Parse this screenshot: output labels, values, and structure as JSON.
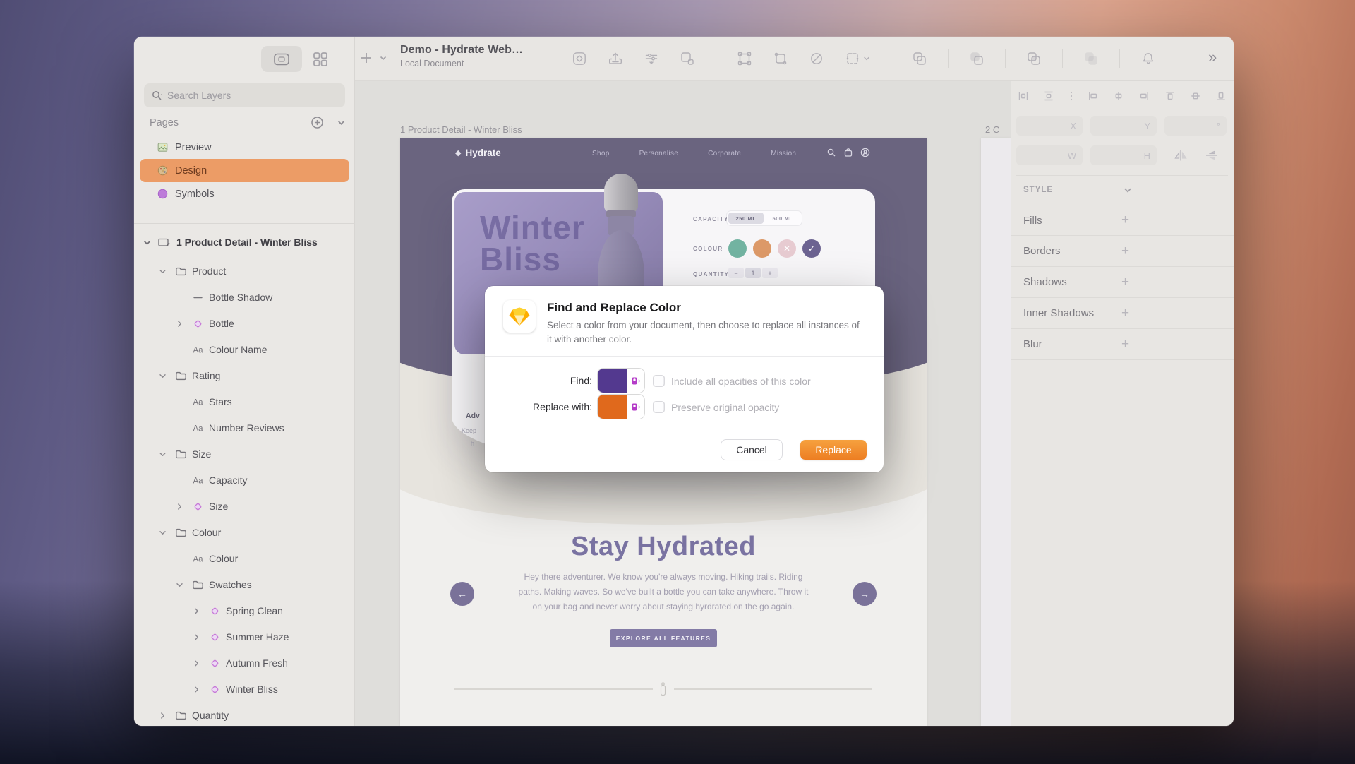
{
  "window": {
    "title": "Demo - Hydrate Web…",
    "subtitle": "Local Document",
    "overflow_glyph": "»"
  },
  "toolbar": {
    "icons": [
      "symbol-tool",
      "upload-tool",
      "tune-tool",
      "mask-tool",
      "sep",
      "vector-edit-tool",
      "transform-tool",
      "no-fill-tool",
      "resize-tool",
      "sep",
      "boolean-union",
      "sep",
      "boolean-subtract",
      "sep",
      "boolean-intersect",
      "sep",
      "boolean-difference",
      "sep",
      "notifications-bell"
    ]
  },
  "sidebar": {
    "search_placeholder": "Search Layers",
    "pages_label": "Pages",
    "pages": [
      {
        "label": "Preview",
        "icon": "page-preview",
        "selected": false
      },
      {
        "label": "Design",
        "icon": "page-design",
        "selected": true
      },
      {
        "label": "Symbols",
        "icon": "page-symbols",
        "selected": false
      }
    ],
    "artboard_label": "1 Product Detail - Winter Bliss",
    "layers": [
      {
        "label": "Product",
        "icon": "folder",
        "level": 1,
        "chevron": "down"
      },
      {
        "label": "Bottle Shadow",
        "icon": "line",
        "level": 2,
        "chevron": "none"
      },
      {
        "label": "Bottle",
        "icon": "symbol",
        "level": 2,
        "chevron": "right"
      },
      {
        "label": "Colour Name",
        "icon": "text",
        "level": 2,
        "chevron": "none"
      },
      {
        "label": "Rating",
        "icon": "folder",
        "level": 1,
        "chevron": "down"
      },
      {
        "label": "Stars",
        "icon": "text",
        "level": 2,
        "chevron": "none"
      },
      {
        "label": "Number Reviews",
        "icon": "text",
        "level": 2,
        "chevron": "none"
      },
      {
        "label": "Size",
        "icon": "folder",
        "level": 1,
        "chevron": "down"
      },
      {
        "label": "Capacity",
        "icon": "text",
        "level": 2,
        "chevron": "none"
      },
      {
        "label": "Size",
        "icon": "symbol",
        "level": 2,
        "chevron": "right"
      },
      {
        "label": "Colour",
        "icon": "folder",
        "level": 1,
        "chevron": "down"
      },
      {
        "label": "Colour",
        "icon": "text",
        "level": 2,
        "chevron": "none"
      },
      {
        "label": "Swatches",
        "icon": "folder",
        "level": 2,
        "chevron": "down"
      },
      {
        "label": "Spring Clean",
        "icon": "symbol",
        "level": 3,
        "chevron": "right"
      },
      {
        "label": "Summer Haze",
        "icon": "symbol",
        "level": 3,
        "chevron": "right"
      },
      {
        "label": "Autumn Fresh",
        "icon": "symbol",
        "level": 3,
        "chevron": "right"
      },
      {
        "label": "Winter Bliss",
        "icon": "symbol",
        "level": 3,
        "chevron": "right"
      },
      {
        "label": "Quantity",
        "icon": "folder",
        "level": 1,
        "chevron": "right"
      }
    ]
  },
  "canvas": {
    "artboard_label": "1 Product Detail - Winter Bliss",
    "artboard2_label": "2 C",
    "site": {
      "logo": "Hydrate",
      "logo_glyph": "◆",
      "nav": [
        "Shop",
        "Personalise",
        "Corporate",
        "Mission"
      ],
      "hero_line1": "Winter",
      "hero_line2": "Bliss",
      "capacity_label": "CAPACITY",
      "capacity_options": [
        {
          "label": "250 ML",
          "selected": true
        },
        {
          "label": "500 ML",
          "selected": false
        }
      ],
      "colour_label": "COLOUR",
      "swatches": [
        {
          "name": "teal",
          "color": "#72b3a1",
          "mark": ""
        },
        {
          "name": "orange",
          "color": "#dc9968",
          "mark": ""
        },
        {
          "name": "pink",
          "color": "#e7cbd1",
          "mark": "✕"
        },
        {
          "name": "purple",
          "color": "#6c6391",
          "mark": "✓"
        }
      ],
      "quantity_label": "QUANTITY",
      "quantity_minus": "−",
      "quantity_value": "1",
      "quantity_plus": "+",
      "fragments": [
        "Adv",
        "Keep",
        "h"
      ],
      "section_title": "Stay Hydrated",
      "section_body": [
        "Hey there adventurer. We know you're always moving. Hiking trails. Riding",
        "paths. Making waves. So we've built a bottle you can take anywhere. Throw it",
        "on your bag and never worry about staying hyrdrated on the go again."
      ],
      "cta": "EXPLORE ALL FEATURES",
      "arrow_left": "←",
      "arrow_right": "→"
    }
  },
  "inspector": {
    "align_icons": [
      "distribute-horizontally",
      "distribute-vertically",
      "more-options-dots",
      "align-left",
      "align-center-horizontal",
      "align-right",
      "align-top",
      "align-middle-vertical",
      "align-bottom"
    ],
    "fields": [
      {
        "suffix": "X"
      },
      {
        "suffix": "Y"
      },
      {
        "suffix": "°"
      },
      {
        "suffix": "W"
      },
      {
        "suffix": "H"
      }
    ],
    "style_label": "STYLE",
    "sections": [
      "Fills",
      "Borders",
      "Shadows",
      "Inner Shadows",
      "Blur"
    ]
  },
  "dialog": {
    "title": "Find and Replace Color",
    "subtitle": "Select a color from your document, then choose to replace all instances of it with another color.",
    "find_label": "Find:",
    "replace_label": "Replace with:",
    "find_color": "#53398f",
    "replace_color": "#e0691c",
    "checkbox1_label": "Include all opacities of this color",
    "checkbox2_label": "Preserve original opacity",
    "cancel_label": "Cancel",
    "replace_button_label": "Replace"
  },
  "colors": {
    "accent_orange": "#ee8434",
    "selected_page_bg": "#ec9c66",
    "hero_purple": "#6a647f",
    "panel_purple_light": "#a89dc9",
    "panel_purple_dark": "#7f759f"
  }
}
